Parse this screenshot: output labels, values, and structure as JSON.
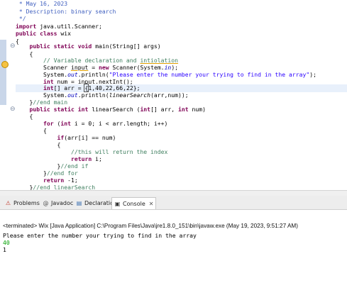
{
  "editor": {
    "lines": [
      " * May 16, 2023",
      " * Description: binary search",
      " */",
      "import java.util.Scanner;",
      "public class wix",
      "{",
      "    public static void main(String[] args)",
      "    {",
      "        // Variable declaration and intiolation",
      "        Scanner input = new Scanner(System.in);",
      "        System.out.println(\"Please enter the number your trying to find in the array\");",
      "        int num = input.nextInt();",
      "        int[] arr = {1,40,22,66,22};",
      "        System.out.println(linearSearch(arr,num));",
      "    }//end main",
      "    public static int linearSearch (int[] arr, int num)",
      "    {",
      "        for (int i = 0; i < arr.length; i++)",
      "        {",
      "            if(arr[i] == num)",
      "            {",
      "                //this will return the index",
      "                return i;",
      "            }//end if",
      "        }//end for",
      "        return -1;",
      "    }//end linearSearch",
      "}"
    ]
  },
  "tabs": [
    {
      "label": "Problems",
      "icon": "problems-icon"
    },
    {
      "label": "Javadoc",
      "icon": "javadoc-icon"
    },
    {
      "label": "Declaration",
      "icon": "declaration-icon"
    },
    {
      "label": "Console",
      "icon": "console-icon",
      "close": "✕"
    }
  ],
  "console": {
    "status": "<terminated> Wix [Java Application] C:\\Program Files\\Java\\jre1.8.0_151\\bin\\javaw.exe (May 19, 2023, 9:51:27 AM)",
    "output": [
      {
        "text": "Please enter the number your trying to find in the array",
        "color": "#000000"
      },
      {
        "text": "40",
        "color": "#00a000"
      },
      {
        "text": "1",
        "color": "#000000"
      }
    ]
  },
  "colors": {
    "keyword": "#7f0055",
    "comment": "#3f7f5f",
    "string": "#2a00ff",
    "input": "#00a000"
  }
}
